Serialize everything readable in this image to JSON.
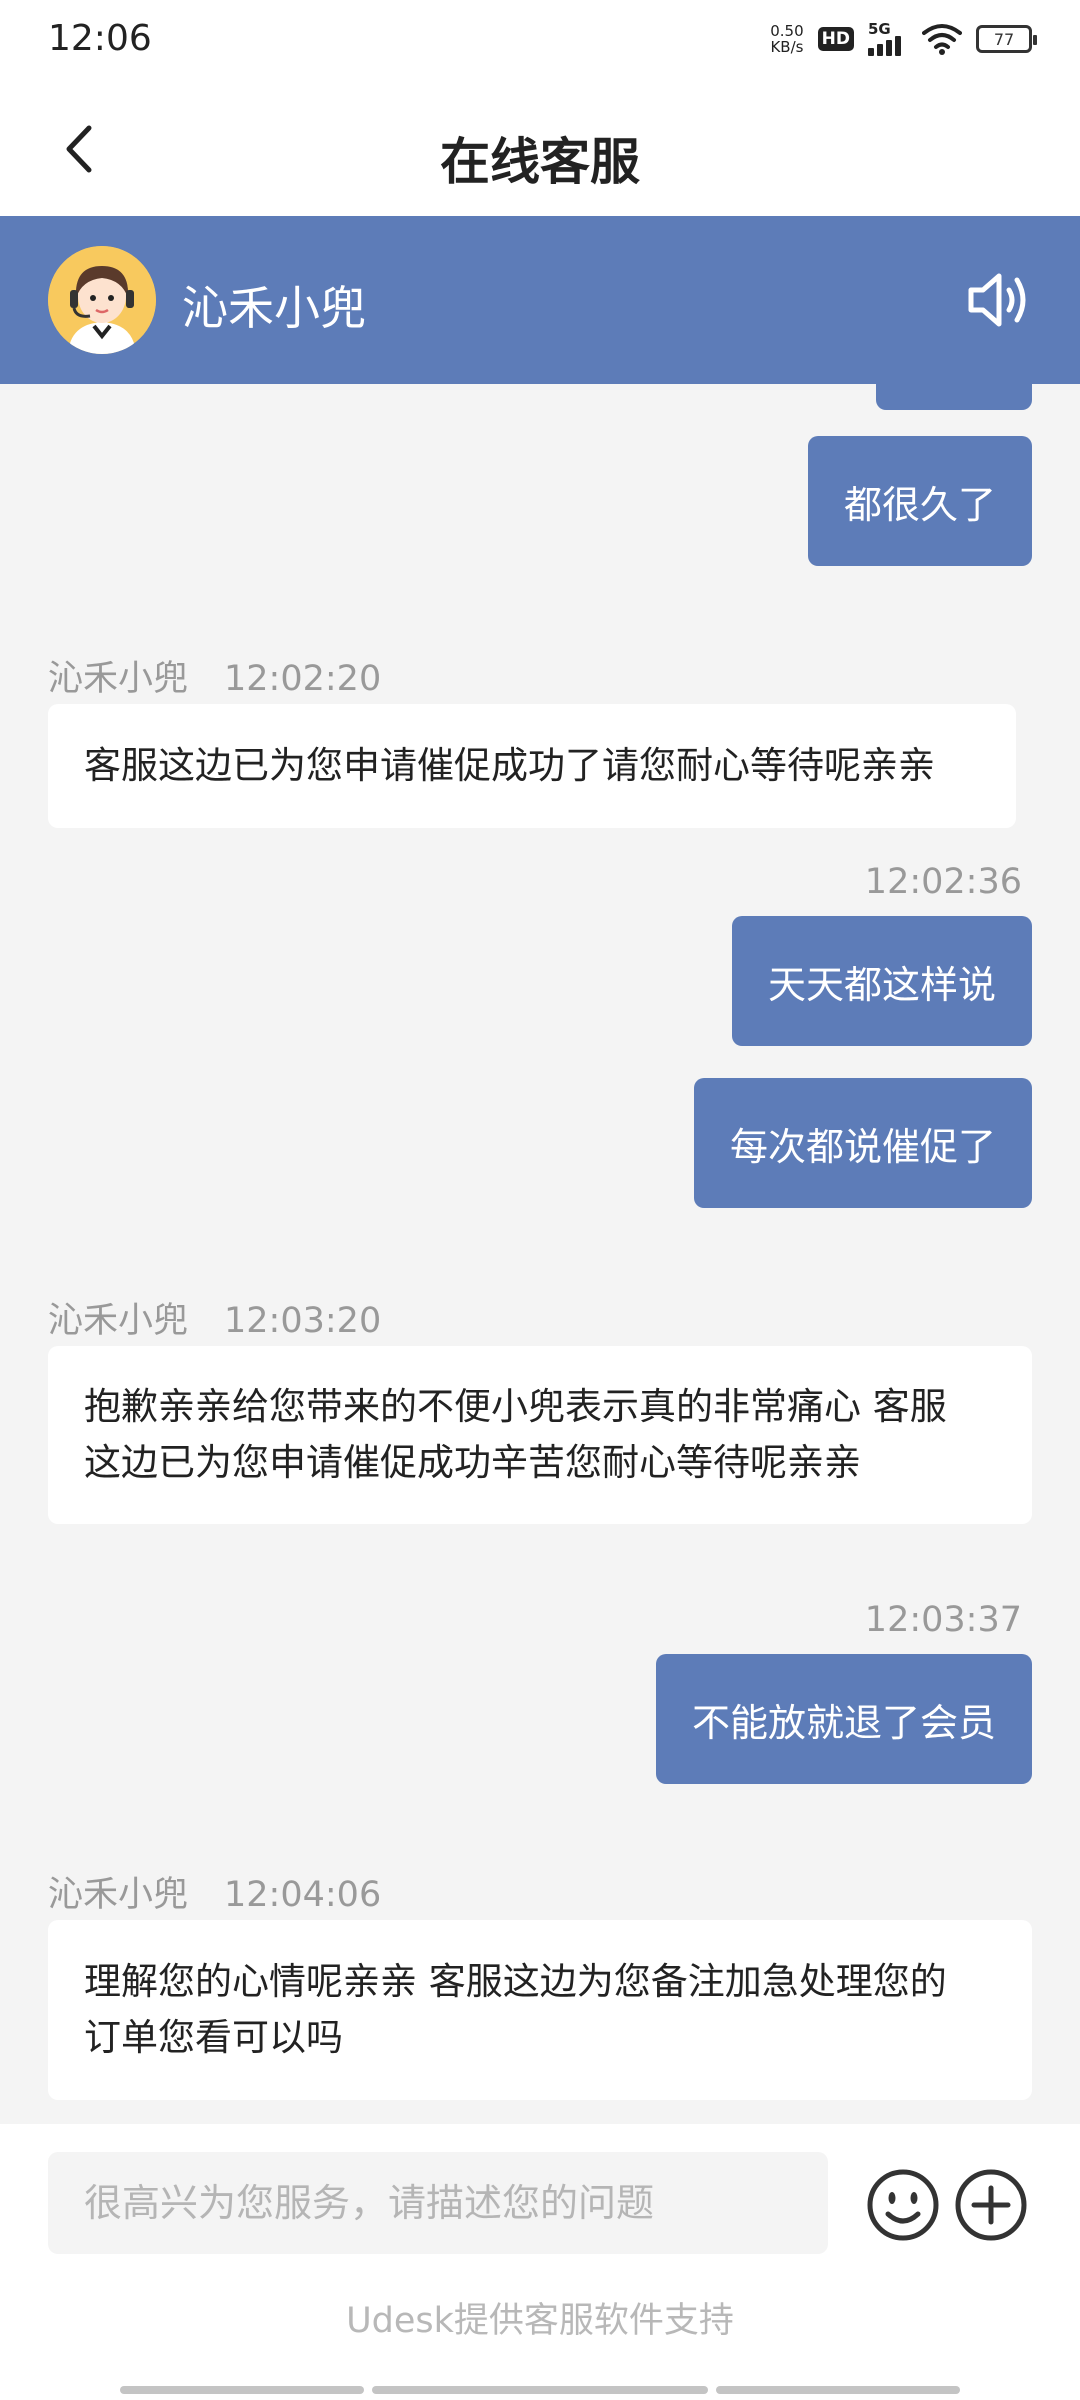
{
  "status_bar": {
    "time": "12:06",
    "net_speed_value": "0.50",
    "net_speed_unit": "KB/s",
    "hd_label": "HD",
    "network_label": "5G",
    "battery": "77",
    "icons": [
      "hd-icon",
      "signal-icon",
      "wifi-icon",
      "battery-icon"
    ]
  },
  "header": {
    "title": "在线客服",
    "back_icon": "chevron-left-icon"
  },
  "agent": {
    "name": "沁禾小兜",
    "avatar_icon": "agent-avatar-icon",
    "speaker_icon": "speaker-icon",
    "accent_color": "#5d7cb8"
  },
  "messages": [
    {
      "side": "out",
      "text": "都很久了"
    },
    {
      "side": "in",
      "sender": "沁禾小兜",
      "time": "12:02:20",
      "text": "客服这边已为您申请催促成功了请您耐心等待呢亲亲"
    },
    {
      "side": "out",
      "time": "12:02:36",
      "text": "天天都这样说"
    },
    {
      "side": "out",
      "text": "每次都说催促了"
    },
    {
      "side": "in",
      "sender": "沁禾小兜",
      "time": "12:03:20",
      "text_lines": [
        "抱歉亲亲给您带来的不便小兜表示真的非常痛心 客服",
        "这边已为您申请催促成功辛苦您耐心等待呢亲亲"
      ]
    },
    {
      "side": "out",
      "time": "12:03:37",
      "text": "不能放就退了会员"
    },
    {
      "side": "in",
      "sender": "沁禾小兜",
      "time": "12:04:06",
      "text_lines": [
        "理解您的心情呢亲亲 客服这边为您备注加急处理您的",
        "订单您看可以吗"
      ]
    }
  ],
  "input": {
    "placeholder": "很高兴为您服务，请描述您的问题",
    "value": "",
    "emoji_icon": "smiley-icon",
    "plus_icon": "plus-circle-icon"
  },
  "footer": {
    "powered_by": "Udesk提供客服软件支持"
  }
}
